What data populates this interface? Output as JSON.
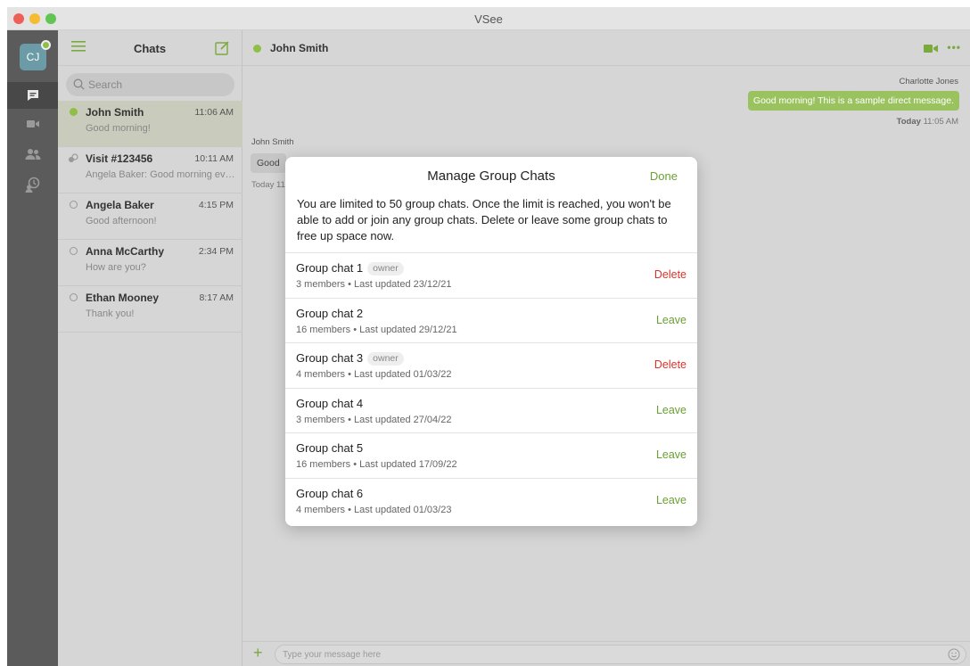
{
  "window": {
    "title": "VSee"
  },
  "user": {
    "initials": "CJ"
  },
  "chat_list": {
    "title": "Chats",
    "search_placeholder": "Search",
    "items": [
      {
        "name": "John Smith",
        "time": "11:06 AM",
        "preview": "Good morning!",
        "status": "online",
        "selected": true
      },
      {
        "name": "Visit #123456",
        "time": "10:11 AM",
        "preview": "Angela Baker: Good morning everyone",
        "status": "group",
        "selected": false
      },
      {
        "name": "Angela Baker",
        "time": "4:15 PM",
        "preview": "Good afternoon!",
        "status": "offline",
        "selected": false
      },
      {
        "name": "Anna McCarthy",
        "time": "2:34 PM",
        "preview": "How are you?",
        "status": "offline",
        "selected": false
      },
      {
        "name": "Ethan Mooney",
        "time": "8:17 AM",
        "preview": "Thank you!",
        "status": "offline",
        "selected": false
      }
    ]
  },
  "conversation": {
    "name": "John Smith",
    "outgoing": {
      "sender": "Charlotte Jones",
      "text": "Good morning! This is a sample direct message.",
      "day": "Today",
      "time": "11:05 AM"
    },
    "incoming": {
      "sender": "John Smith",
      "text": "Good",
      "timestamp": "Today 11"
    },
    "input_placeholder": "Type your message here"
  },
  "modal": {
    "title": "Manage Group Chats",
    "done_label": "Done",
    "description": "You are limited to 50 group chats. Once the limit is reached, you won't be able to add or join any group chats. Delete or leave some group chats to free up space now.",
    "owner_label": "owner",
    "groups": [
      {
        "name": "Group chat 1",
        "owner": true,
        "meta": "3 members • Last updated 23/12/21",
        "action": "Delete"
      },
      {
        "name": "Group chat 2",
        "owner": false,
        "meta": "16 members • Last updated 29/12/21",
        "action": "Leave"
      },
      {
        "name": "Group chat 3",
        "owner": true,
        "meta": "4 members • Last updated 01/03/22",
        "action": "Delete"
      },
      {
        "name": "Group chat 4",
        "owner": false,
        "meta": "3 members • Last updated 27/04/22",
        "action": "Leave"
      },
      {
        "name": "Group chat 5",
        "owner": false,
        "meta": "16 members • Last updated 17/09/22",
        "action": "Leave"
      },
      {
        "name": "Group chat 6",
        "owner": false,
        "meta": "4 members • Last updated 01/03/23",
        "action": "Leave"
      }
    ]
  },
  "colors": {
    "accent": "#8fbf47",
    "delete": "#d9342b",
    "leave": "#6aa034"
  },
  "icons": [
    "hamburger-icon",
    "compose-icon",
    "search-icon",
    "chat-icon",
    "video-icon",
    "contacts-icon",
    "history-icon",
    "camera-icon",
    "more-icon",
    "plus-icon",
    "emoji-icon",
    "group-icon"
  ]
}
